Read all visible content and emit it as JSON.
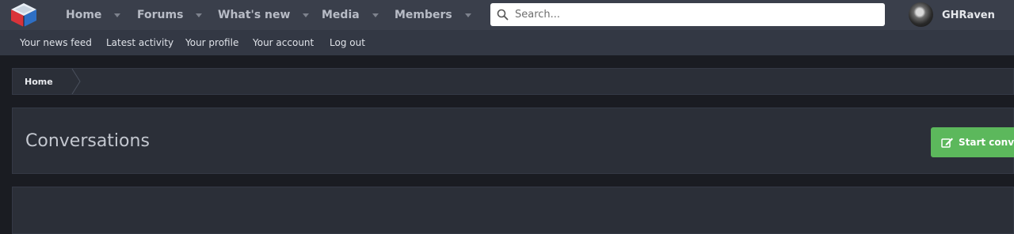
{
  "nav": {
    "items": [
      {
        "label": "Home"
      },
      {
        "label": "Forums"
      },
      {
        "label": "What's new"
      },
      {
        "label": "Media"
      },
      {
        "label": "Members"
      }
    ],
    "search_placeholder": "Search...",
    "username": "GHRaven"
  },
  "subnav": {
    "items": [
      {
        "label": "Your news feed"
      },
      {
        "label": "Latest activity"
      },
      {
        "label": "Your profile"
      },
      {
        "label": "Your account"
      },
      {
        "label": "Log out"
      }
    ]
  },
  "breadcrumb": {
    "home": "Home"
  },
  "main": {
    "title": "Conversations",
    "start_button": "Start conversation"
  },
  "colors": {
    "accent_green": "#5cb85c",
    "topnav_bg": "#3a3f4b",
    "page_bg": "#1a1c22"
  }
}
